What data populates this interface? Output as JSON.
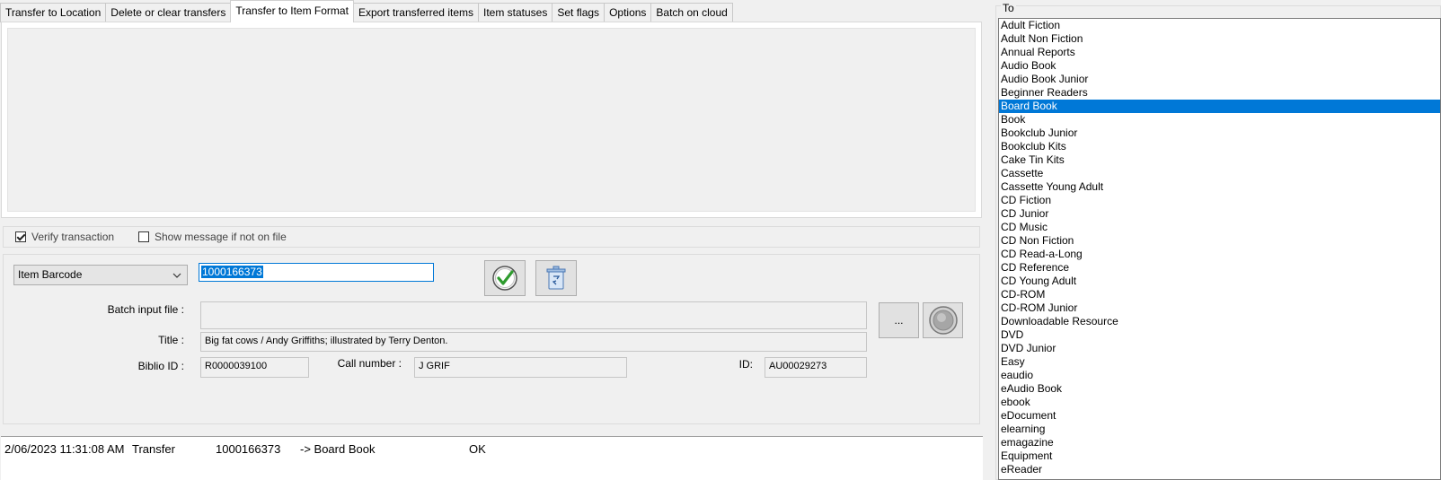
{
  "tabs": [
    {
      "label": "Transfer to Location",
      "active": false
    },
    {
      "label": "Delete or clear transfers",
      "active": false
    },
    {
      "label": "Transfer to Item Format",
      "active": true
    },
    {
      "label": "Export transferred items",
      "active": false
    },
    {
      "label": "Item statuses",
      "active": false
    },
    {
      "label": "Set flags",
      "active": false
    },
    {
      "label": "Options",
      "active": false
    },
    {
      "label": "Batch on cloud",
      "active": false
    }
  ],
  "options": {
    "verify_label": "Verify transaction",
    "verify_checked": true,
    "show_message_label": "Show message if not on file",
    "show_message_checked": false
  },
  "form": {
    "type_select_value": "Item Barcode",
    "barcode_value": "1000166373",
    "batch_label": "Batch input file :",
    "batch_value": "",
    "browse_label": "...",
    "title_label": "Title :",
    "title_value": "Big fat cows / Andy Griffiths; illustrated by Terry Denton.",
    "biblio_label": "Biblio ID :",
    "biblio_value": "R0000039100",
    "call_label": "Call number :",
    "call_value": "J GRIF",
    "id_label": "ID:",
    "id_value": "AU00029273"
  },
  "log": [
    {
      "time": "2/06/2023 11:31:08 AM",
      "action": "Transfer",
      "barcode": "1000166373",
      "target": "-> Board Book",
      "status": "OK"
    }
  ],
  "to_panel": {
    "label": "To",
    "selected": "Board Book",
    "items": [
      "Adult Fiction",
      "Adult Non Fiction",
      "Annual Reports",
      "Audio Book",
      "Audio Book Junior",
      "Beginner Readers",
      "Board Book",
      "Book",
      "Bookclub Junior",
      "Bookclub Kits",
      "Cake Tin Kits",
      "Cassette",
      "Cassette Young Adult",
      "CD Fiction",
      "CD Junior",
      "CD Music",
      "CD Non Fiction",
      "CD Read-a-Long",
      "CD Reference",
      "CD Young Adult",
      "CD-ROM",
      "CD-ROM Junior",
      "Downloadable Resource",
      "DVD",
      "DVD Junior",
      "Easy",
      "eaudio",
      "eAudio Book",
      "ebook",
      "eDocument",
      "elearning",
      "emagazine",
      "Equipment",
      "eReader"
    ]
  },
  "icons": {
    "confirm": "check-circle-icon",
    "clear": "recycle-bin-icon",
    "go": "round-go-icon",
    "dropdown": "chevron-down-icon"
  },
  "colors": {
    "selection": "#0078d7",
    "check_green": "#2e9b2e"
  }
}
